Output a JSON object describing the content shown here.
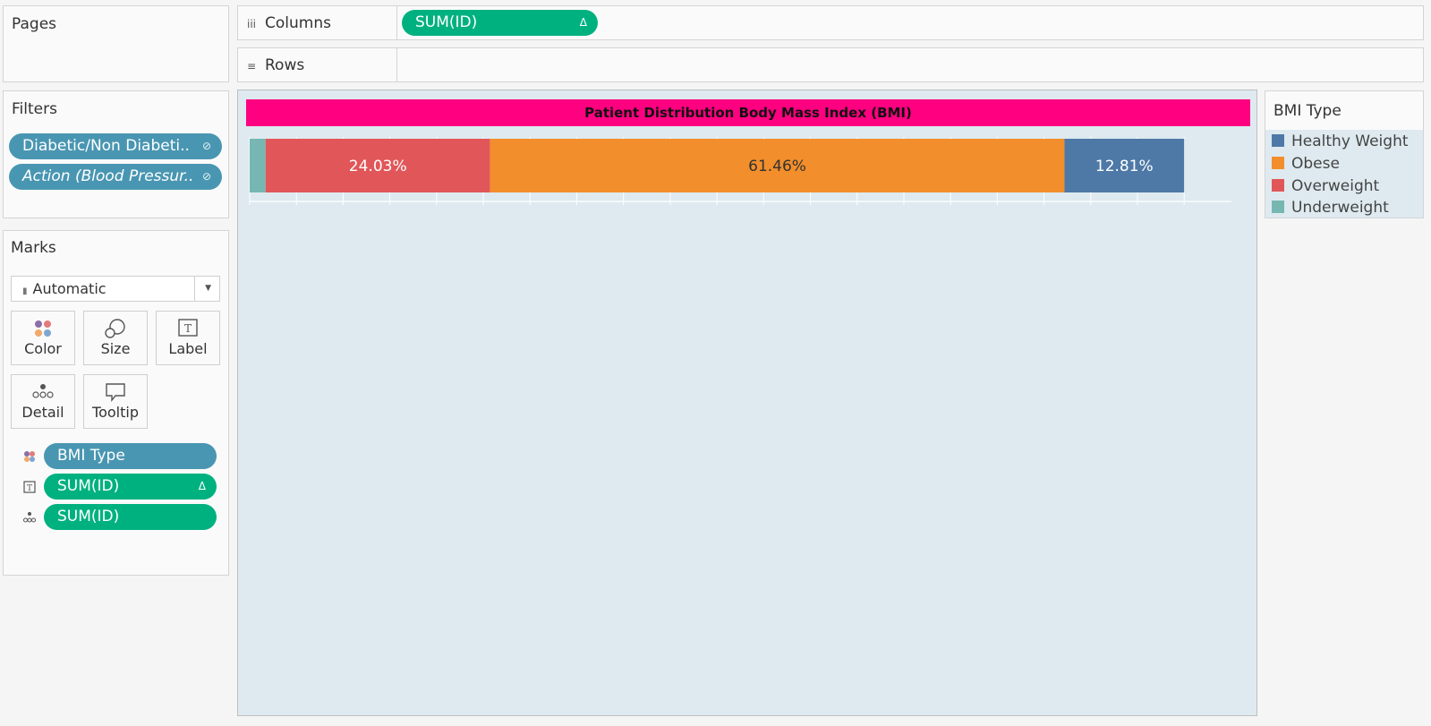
{
  "pages": {
    "title": "Pages"
  },
  "columns": {
    "label": "Columns",
    "pill": "SUM(ID)",
    "pill_icon": "Δ"
  },
  "rows": {
    "label": "Rows"
  },
  "filters": {
    "title": "Filters",
    "items": [
      {
        "label": "Diabetic/Non Diabeti..",
        "italic": false
      },
      {
        "label": "Action (Blood Pressur..",
        "italic": true
      }
    ]
  },
  "marks": {
    "title": "Marks",
    "mark_type": "Automatic",
    "buttons": [
      "Color",
      "Size",
      "Label",
      "Detail",
      "Tooltip"
    ],
    "encodings": [
      {
        "label": "BMI Type",
        "kind": "color",
        "pill_color": "blue",
        "icon": ""
      },
      {
        "label": "SUM(ID)",
        "kind": "label",
        "pill_color": "green",
        "icon": "Δ"
      },
      {
        "label": "SUM(ID)",
        "kind": "detail",
        "pill_color": "green",
        "icon": ""
      }
    ]
  },
  "chart_data": {
    "type": "bar",
    "title": "Patient Distribution Body Mass Index (BMI)",
    "orientation": "horizontal-stacked",
    "x_range": [
      0,
      100
    ],
    "gridlines": true,
    "series": [
      {
        "name": "Underweight",
        "value": 1.7,
        "label": "",
        "color": "#76b7b2"
      },
      {
        "name": "Overweight",
        "value": 24.03,
        "label": "24.03%",
        "color": "#e15759"
      },
      {
        "name": "Obese",
        "value": 61.46,
        "label": "61.46%",
        "color": "#f28e2b"
      },
      {
        "name": "Healthy Weight",
        "value": 12.81,
        "label": "12.81%",
        "color": "#4e79a7"
      }
    ]
  },
  "legend": {
    "title": "BMI Type",
    "items": [
      {
        "label": "Healthy Weight",
        "color": "#4e79a7"
      },
      {
        "label": "Obese",
        "color": "#f28e2b"
      },
      {
        "label": "Overweight",
        "color": "#e15759"
      },
      {
        "label": "Underweight",
        "color": "#76b7b2"
      }
    ]
  }
}
